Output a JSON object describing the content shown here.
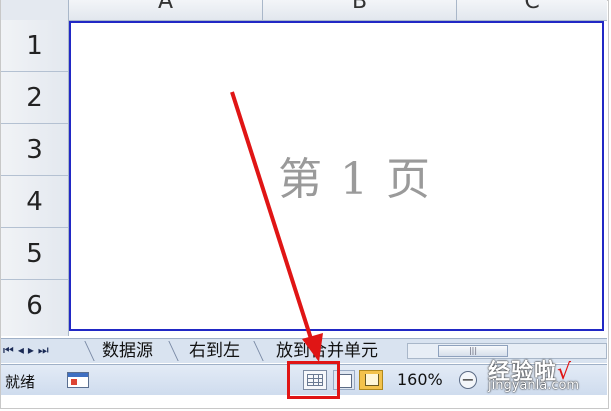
{
  "columns": [
    "A",
    "B",
    "C"
  ],
  "rows": [
    "1",
    "2",
    "3",
    "4",
    "5",
    "6"
  ],
  "page_label": "第 1 页",
  "sheet_nav": {
    "first": "◂",
    "prev": "◂",
    "next": "▸",
    "last": "▸"
  },
  "sheet_tabs": [
    "数据源",
    "右到左",
    "放到合并单元"
  ],
  "scroll_thumb": "|||",
  "status": {
    "ready": "就绪",
    "zoom": "160%",
    "zoom_out": "−"
  },
  "watermark": {
    "main": "经验啦",
    "check": "√",
    "url": "jingyanla.com"
  },
  "colors": {
    "page_border": "#2128c5",
    "annotation_red": "#e01515"
  }
}
